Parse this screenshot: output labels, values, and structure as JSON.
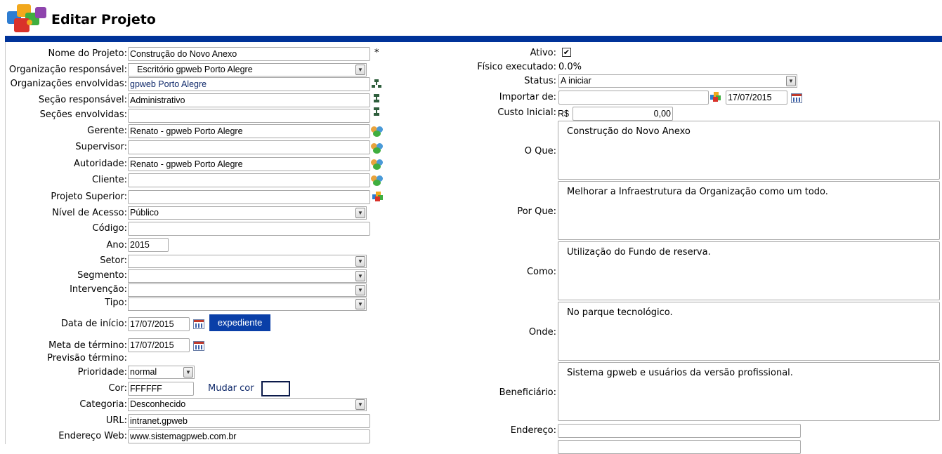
{
  "header": {
    "title": "Editar Projeto",
    "bar_color": "#003399",
    "logo_icon": "puzzle-logo-icon"
  },
  "left": {
    "nome": {
      "label": "Nome do Projeto:",
      "value": "Construção do Novo Anexo",
      "required": "*"
    },
    "org_resp": {
      "label": "Organização responsável:",
      "value": "Escritório gpweb Porto Alegre"
    },
    "org_env": {
      "label": "Organizações envolvidas:",
      "value": "gpweb Porto Alegre"
    },
    "secao_resp": {
      "label": "Seção responsável:",
      "value": "Administrativo"
    },
    "secoes_env": {
      "label": "Seções envolvidas:",
      "value": ""
    },
    "gerente": {
      "label": "Gerente:",
      "value": "Renato - gpweb Porto Alegre"
    },
    "supervisor": {
      "label": "Supervisor:",
      "value": ""
    },
    "autoridade": {
      "label": "Autoridade:",
      "value": "Renato - gpweb Porto Alegre"
    },
    "cliente": {
      "label": "Cliente:",
      "value": ""
    },
    "superior": {
      "label": "Projeto Superior:",
      "value": ""
    },
    "nivel": {
      "label": "Nível de Acesso:",
      "value": "Público"
    },
    "codigo": {
      "label": "Código:",
      "value": ""
    },
    "ano": {
      "label": "Ano:",
      "value": "2015"
    },
    "setor": {
      "label": "Setor:",
      "value": ""
    },
    "segmento": {
      "label": "Segmento:",
      "value": ""
    },
    "intervencao": {
      "label": "Intervenção:",
      "value": ""
    },
    "tipo": {
      "label": "Tipo:",
      "value": ""
    },
    "data_inicio": {
      "label": "Data de início:",
      "value": "17/07/2015",
      "button": "expediente"
    },
    "meta_termino": {
      "label": "Meta de término:",
      "value": "17/07/2015"
    },
    "previsao": {
      "label": "Previsão término:"
    },
    "prioridade": {
      "label": "Prioridade:",
      "value": "normal"
    },
    "cor": {
      "label": "Cor:",
      "value": "FFFFFF",
      "link": "Mudar cor",
      "swatch": "#FFFFFF"
    },
    "categoria": {
      "label": "Categoria:",
      "value": "Desconhecido"
    },
    "url": {
      "label": "URL:",
      "value": "intranet.gpweb"
    },
    "endereco_web": {
      "label": "Endereço Web:",
      "value": "www.sistemagpweb.com.br"
    }
  },
  "right": {
    "ativo": {
      "label": "Ativo:",
      "checked": true
    },
    "fisico": {
      "label": "Físico executado:",
      "value": "0.0%"
    },
    "status": {
      "label": "Status:",
      "value": "A iniciar"
    },
    "importar": {
      "label": "Importar de:",
      "value": "",
      "date": "17/07/2015"
    },
    "custo": {
      "label": "Custo Inicial:",
      "currency": "R$",
      "value": "0,00"
    },
    "o_que": {
      "label": "O Que:",
      "value": "Construção do Novo Anexo"
    },
    "por_que": {
      "label": "Por Que:",
      "value": "Melhorar a Infraestrutura da Organização como um todo."
    },
    "como": {
      "label": "Como:",
      "value": "Utilização do Fundo de reserva."
    },
    "onde": {
      "label": "Onde:",
      "value": "No parque tecnológico."
    },
    "beneficiario": {
      "label": "Beneficiário:",
      "value": "Sistema gpweb e usuários da versão profissional."
    },
    "endereco": {
      "label": "Endereço:",
      "value": ""
    }
  }
}
